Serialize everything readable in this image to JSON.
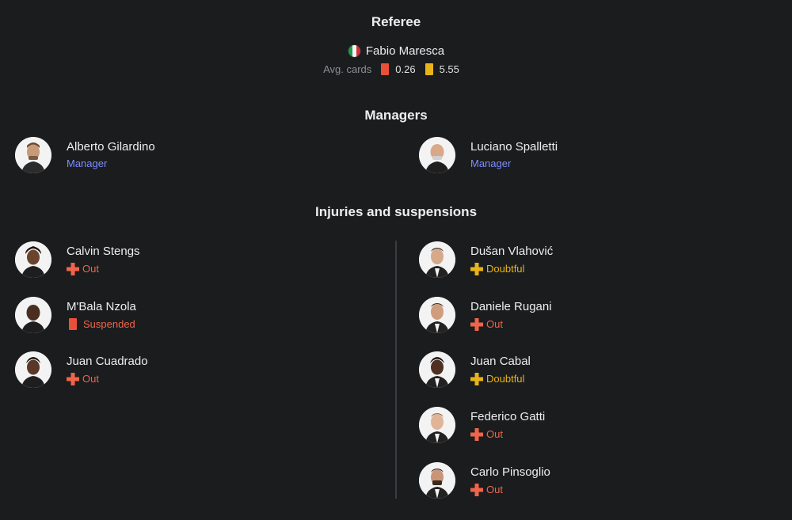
{
  "referee": {
    "title": "Referee",
    "name": "Fabio Maresca",
    "flag_icon": "italy-flag-icon",
    "cards_label": "Avg. cards",
    "red_avg": "0.26",
    "yellow_avg": "5.55",
    "colors": {
      "red": "#e8503a",
      "yellow": "#e8b41a"
    }
  },
  "managers": {
    "title": "Managers",
    "home": {
      "name": "Alberto Gilardino",
      "role": "Manager"
    },
    "away": {
      "name": "Luciano Spalletti",
      "role": "Manager"
    }
  },
  "injuries": {
    "title": "Injuries and suspensions",
    "home": [
      {
        "name": "Calvin Stengs",
        "status": "Out",
        "icon": "plus-icon"
      },
      {
        "name": "M'Bala Nzola",
        "status": "Suspended",
        "icon": "red-card-icon"
      },
      {
        "name": "Juan Cuadrado",
        "status": "Out",
        "icon": "plus-icon"
      }
    ],
    "away": [
      {
        "name": "Dušan Vlahović",
        "status": "Doubtful",
        "icon": "plus-icon"
      },
      {
        "name": "Daniele Rugani",
        "status": "Out",
        "icon": "plus-icon"
      },
      {
        "name": "Juan Cabal",
        "status": "Doubtful",
        "icon": "plus-icon"
      },
      {
        "name": "Federico Gatti",
        "status": "Out",
        "icon": "plus-icon"
      },
      {
        "name": "Carlo Pinsoglio",
        "status": "Out",
        "icon": "plus-icon"
      }
    ]
  },
  "theme": {
    "background": "#1a1c1e",
    "manager_role_color": "#7d8cff",
    "out_color": "#f0644a",
    "doubtful_color": "#e8b41a"
  }
}
